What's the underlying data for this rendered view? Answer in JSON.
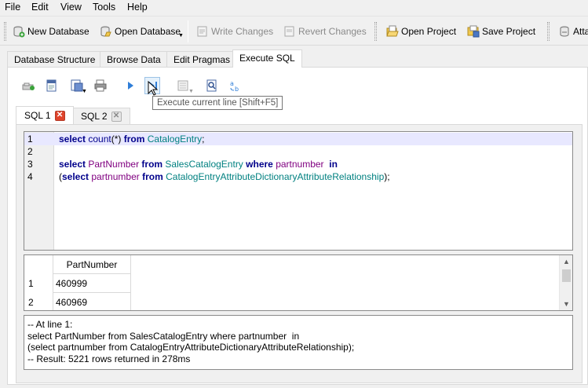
{
  "menu": {
    "file": "File",
    "edit": "Edit",
    "view": "View",
    "tools": "Tools",
    "help": "Help"
  },
  "toolbar": {
    "new_database": "New Database",
    "open_database": "Open Database",
    "write_changes": "Write Changes",
    "revert_changes": "Revert Changes",
    "open_project": "Open Project",
    "save_project": "Save Project",
    "attach": "Atta"
  },
  "main_tabs": [
    "Database Structure",
    "Browse Data",
    "Edit Pragmas",
    "Execute SQL"
  ],
  "tooltip": "Execute current line [Shift+F5]",
  "sql_tabs": [
    "SQL 1",
    "SQL 2"
  ],
  "editor": {
    "line_numbers": [
      "1",
      "2",
      "3",
      "4"
    ],
    "line1": {
      "kw1": "select",
      "fn": "count",
      "rest1": "(*) ",
      "kw2": "from",
      "tbl": "CatalogEntry",
      "end": ";"
    },
    "line3": {
      "kw1": "select",
      "col1": "PartNumber",
      "kw2": "from",
      "tbl": "SalesCatalogEntry",
      "kw3": "where",
      "col2": "partnumber",
      "kw4": "in"
    },
    "line4": {
      "open": "(",
      "kw1": "select",
      "col1": "partnumber",
      "kw2": "from",
      "tbl": "CatalogEntryAttributeDictionaryAttributeRelationship",
      "end": ");"
    }
  },
  "results": {
    "column": "PartNumber",
    "rows": [
      {
        "num": "1",
        "value": "460999"
      },
      {
        "num": "2",
        "value": "460969"
      }
    ]
  },
  "message": {
    "line1": "-- At line 1:",
    "line2": "select PartNumber from SalesCatalogEntry where partnumber  in",
    "line3": "(select partnumber from CatalogEntryAttributeDictionaryAttributeRelationship);",
    "line4": "-- Result: 5221 rows returned in 278ms"
  }
}
